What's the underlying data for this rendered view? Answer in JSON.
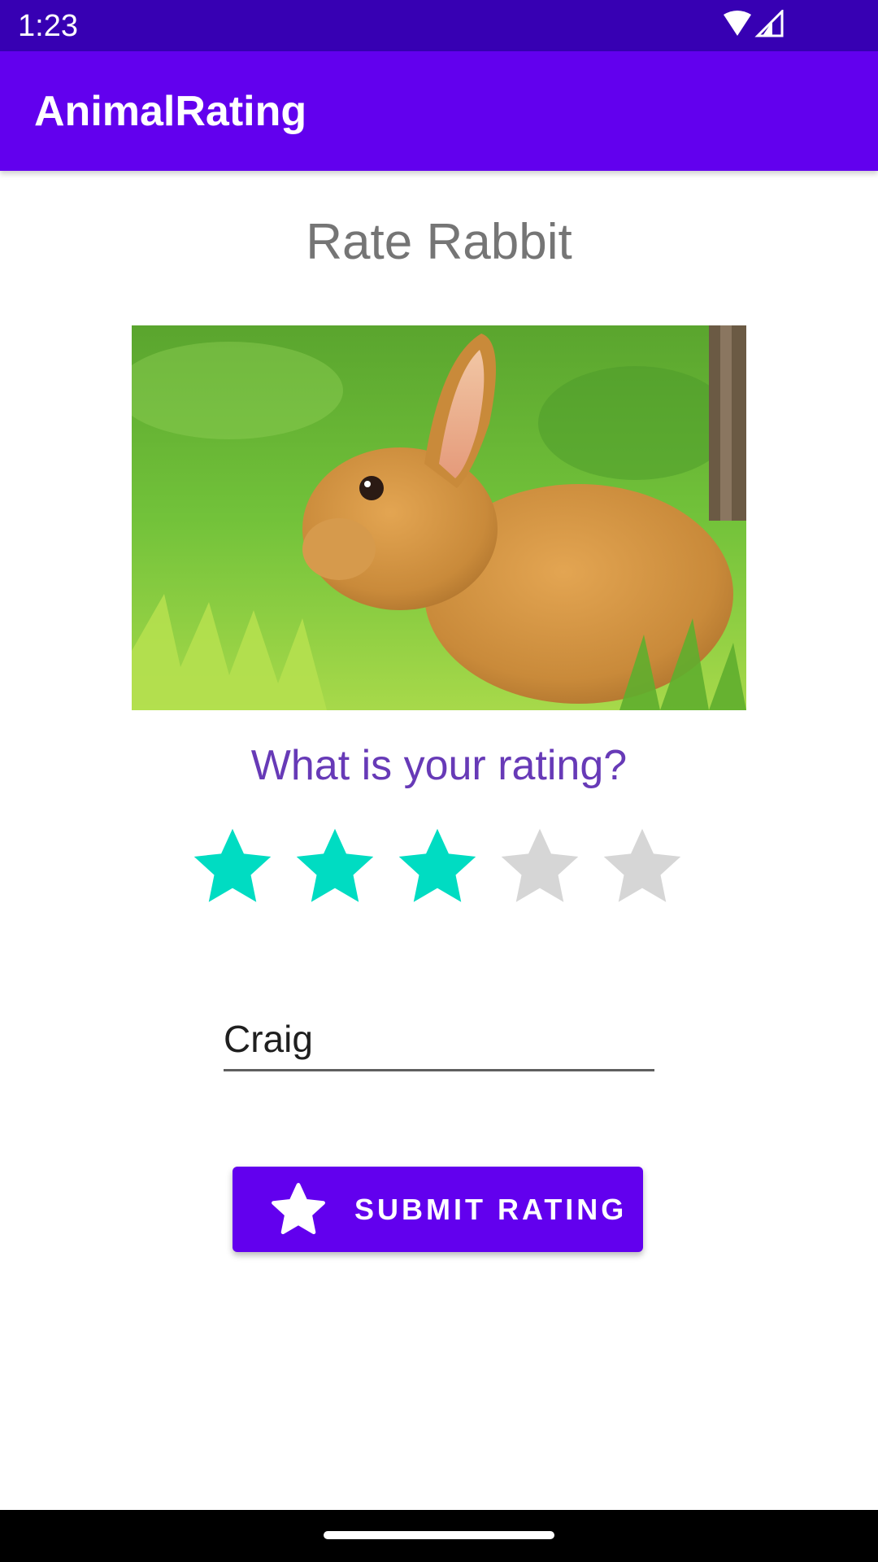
{
  "status_bar": {
    "time": "1:23",
    "icons": [
      "wifi-icon",
      "cellular-signal-icon"
    ],
    "background": "#3700b3"
  },
  "app_bar": {
    "title": "AnimalRating",
    "background": "#6200ee"
  },
  "main": {
    "heading": "Rate Rabbit",
    "question": "What is your rating?",
    "rating": {
      "value": 3,
      "max": 5,
      "filled_color": "#00dcc2",
      "empty_color": "#d6d6d6"
    },
    "name_field": {
      "value": "Craig"
    },
    "submit_button": {
      "label": "SUBMIT RATING",
      "icon": "star-icon"
    }
  },
  "colors": {
    "accent": "#6200ee",
    "question_text": "#673ab7",
    "heading_text": "#757575"
  }
}
